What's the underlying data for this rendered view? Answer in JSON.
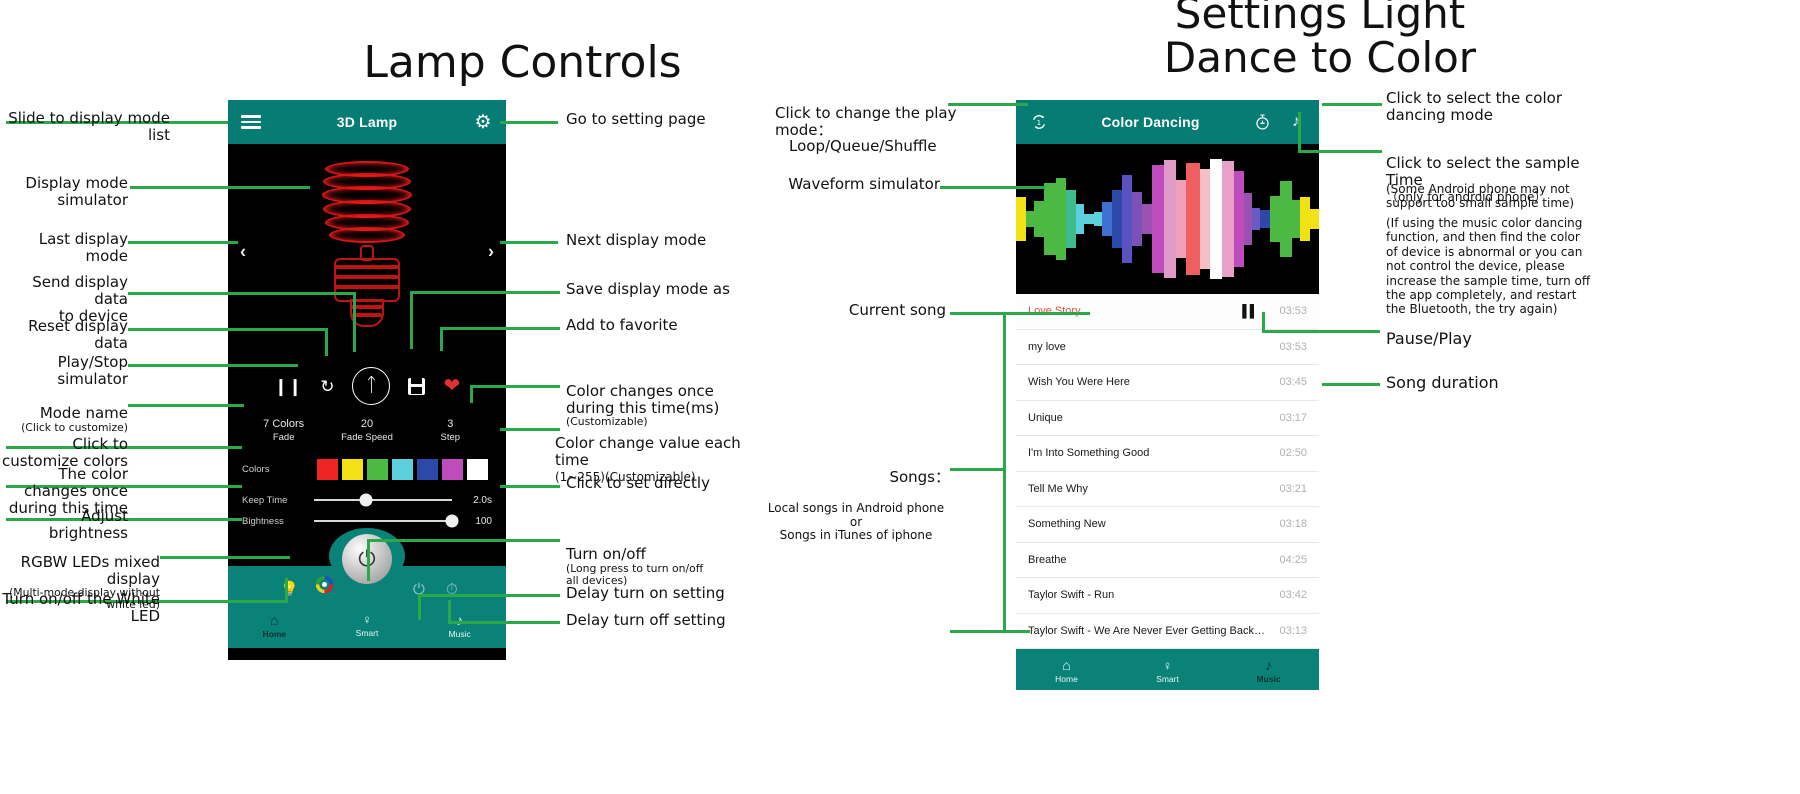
{
  "headings": {
    "left": "Lamp Controls",
    "right": "Settings Light\nDance to Color"
  },
  "left_phone": {
    "appbar": {
      "menu_icon": "hamburger-icon",
      "title": "3D Lamp",
      "settings_icon": "gear-icon"
    },
    "nav": {
      "prev": "‹",
      "next": "›"
    },
    "controls": {
      "pause_icon": "pause-icon",
      "reset_icon": "refresh-icon",
      "bluetooth_icon": "bluetooth-icon",
      "save_icon": "save-icon",
      "favorite_icon": "heart-icon"
    },
    "mode": {
      "name_line1": "7 Colors",
      "name_line2": "Fade",
      "fade_speed_value": "20",
      "fade_speed_label": "Fade Speed",
      "step_value": "3",
      "step_label": "Step"
    },
    "colors_label": "Colors",
    "swatches": [
      "#ef2525",
      "#f2e215",
      "#4cb944",
      "#5ccfdd",
      "#2d49a8",
      "#c04bbc",
      "#ffffff"
    ],
    "keep_time": {
      "label": "Keep Time",
      "value": "2.0s",
      "percent": 38
    },
    "brightness": {
      "label": "Bightness",
      "value": "100",
      "percent": 100
    },
    "teal_bar": {
      "white_led_icon": "white-led-bulb-icon",
      "rgb_icon": "rgb-color-wheel-icon",
      "power_icon": "power-icon",
      "delay_on_icon": "delay-power-on-icon",
      "delay_off_icon": "delay-timer-off-icon"
    },
    "tabs": [
      {
        "icon": "home-icon",
        "label": "Home",
        "glyph": "⌂"
      },
      {
        "icon": "bulb-icon",
        "label": "Smart",
        "glyph": "Ὂ1"
      },
      {
        "icon": "music-icon",
        "label": "Music",
        "glyph": "♪"
      }
    ]
  },
  "right_phone": {
    "appbar": {
      "play_mode_icon": "repeat-one-icon",
      "title": "Color Dancing",
      "sample_time_icon": "stopwatch-icon",
      "music_icon": "music-note-icon"
    },
    "waveform_colors": [
      "#f2e215",
      "#4cb944",
      "#5ccfdd",
      "#2d49a8",
      "#6a5bc4",
      "#c04bbc",
      "#e8a0c8",
      "#ef5f5f",
      "#ffffff"
    ],
    "songs": [
      {
        "name": "Love Story",
        "duration": "03:53",
        "current": true
      },
      {
        "name": "my love",
        "duration": "03:53",
        "current": false
      },
      {
        "name": "Wish You Were Here",
        "duration": "03:45",
        "current": false
      },
      {
        "name": "Unique",
        "duration": "03:17",
        "current": false
      },
      {
        "name": "I'm Into Something Good",
        "duration": "02:50",
        "current": false
      },
      {
        "name": "Tell Me Why",
        "duration": "03:21",
        "current": false
      },
      {
        "name": "Something New",
        "duration": "03:18",
        "current": false
      },
      {
        "name": "Breathe",
        "duration": "04:25",
        "current": false
      },
      {
        "name": "Taylor Swift - Run",
        "duration": "03:42",
        "current": false
      },
      {
        "name": "Taylor Swift - We Are Never Ever Getting Back …",
        "duration": "03:13",
        "current": false
      }
    ],
    "pause_icon": "pause-icon",
    "tabs": [
      {
        "icon": "home-icon",
        "label": "Home",
        "glyph": "⌂"
      },
      {
        "icon": "bulb-icon",
        "label": "Smart",
        "glyph": "Ὂ1"
      },
      {
        "icon": "music-icon",
        "label": "Music",
        "glyph": "♪"
      }
    ]
  },
  "annotations": {
    "a1": "Slide to display mode list",
    "a2": "Display mode simulator",
    "a3": "Last display mode",
    "a4": "Send display data\nto device",
    "a5": "Reset display data",
    "a6": "Play/Stop simulator",
    "a7_main": "Mode name",
    "a7_sub": "(Click to customize)",
    "a8": "Click to customize colors",
    "a9": "The color changes once\nduring this time",
    "a10": "Adjust brightness",
    "a11_main": "RGBW LEDs mixed display",
    "a11_sub": "(Multi-mode display without\nwhite led)",
    "a12": "Turn on/off the White LED",
    "b1": "Go to setting page",
    "b2": "Next display mode",
    "b3": "Save  display mode as",
    "b4": "Add to favorite",
    "b5_main": "Color changes once\nduring this time(ms)",
    "b5_sub": "(Customizable)",
    "b6_main": "Color change value each\ntime",
    "b6_sub": "(1~255)(Customizable)",
    "b7": "Click to set directly",
    "b8_main": "Turn on/off",
    "b8_sub": "(Long press to turn on/off\nall devices)",
    "b9": "Delay turn on setting",
    "b10": "Delay turn off setting",
    "c1_main": "Click to change the play\nmode：",
    "c1_sub": "Loop/Queue/Shuffle",
    "c2": "Waveform simulator",
    "c3": "Current song",
    "c4_main": "Songs：",
    "c4_sub": "Local songs in Android phone\nor\nSongs in iTunes of iphone",
    "d1": "Click to select the color\ndancing mode",
    "d2_main": "Click to select the sample\nTime",
    "d2_paren": "（only for android  phone）",
    "d2_note1": "(Some Android phone may not\n support too small sample time)",
    "d2_note2": "(If using the music  color dancing\nfunction, and then find the color\nof device is abnormal or you can\nnot  control the device, please\nincrease the sample time, turn off\nthe app completely, and restart\nthe Bluetooth, the try again)",
    "d3": "Pause/Play",
    "d4": "Song duration"
  }
}
